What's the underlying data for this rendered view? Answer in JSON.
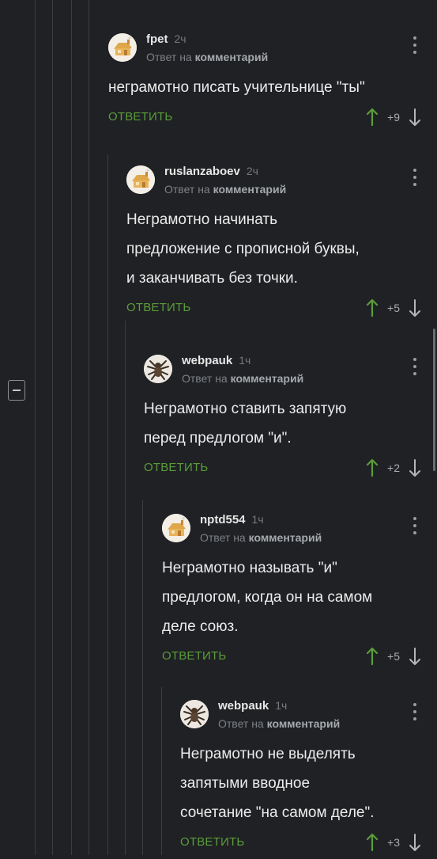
{
  "comments": [
    {
      "username": "fpet",
      "time": "2ч",
      "reply_prefix": "Ответ на",
      "reply_target": "комментарий",
      "text": [
        "неграмотно писать учительнице \"ты\""
      ],
      "reply_label": "ОТВЕТИТЬ",
      "score": "+9",
      "avatar": "house-avatar-icon"
    },
    {
      "username": "ruslanzaboev",
      "time": "2ч",
      "reply_prefix": "Ответ на",
      "reply_target": "комментарий",
      "text": [
        "Неграмотно начинать",
        "предложение с прописной буквы,",
        "и заканчивать без точки."
      ],
      "reply_label": "ОТВЕТИТЬ",
      "score": "+5",
      "avatar": "house-avatar-icon"
    },
    {
      "username": "webpauk",
      "time": "1ч",
      "reply_prefix": "Ответ на",
      "reply_target": "комментарий",
      "text": [
        "Неграмотно ставить запятую",
        "перед предлогом \"и\"."
      ],
      "reply_label": "ОТВЕТИТЬ",
      "score": "+2",
      "avatar": "spider-avatar-icon"
    },
    {
      "username": "nptd554",
      "time": "1ч",
      "reply_prefix": "Ответ на",
      "reply_target": "комментарий",
      "text": [
        "Неграмотно называть \"и\"",
        "предлогом, когда он на самом",
        "деле союз."
      ],
      "reply_label": "ОТВЕТИТЬ",
      "score": "+5",
      "avatar": "house-avatar-icon"
    },
    {
      "username": "webpauk",
      "time": "1ч",
      "reply_prefix": "Ответ на",
      "reply_target": "комментарий",
      "text": [
        "Неграмотно не выделять",
        "запятыми вводное",
        "сочетание \"на самом деле\"."
      ],
      "reply_label": "ОТВЕТИТЬ",
      "score": "+3",
      "avatar": "spider-avatar-icon"
    }
  ],
  "colors": {
    "background": "#1f2124",
    "reply_green": "#5b9d3a",
    "upvote_green": "#5b9d3a",
    "thread_line": "#3a3d41"
  }
}
